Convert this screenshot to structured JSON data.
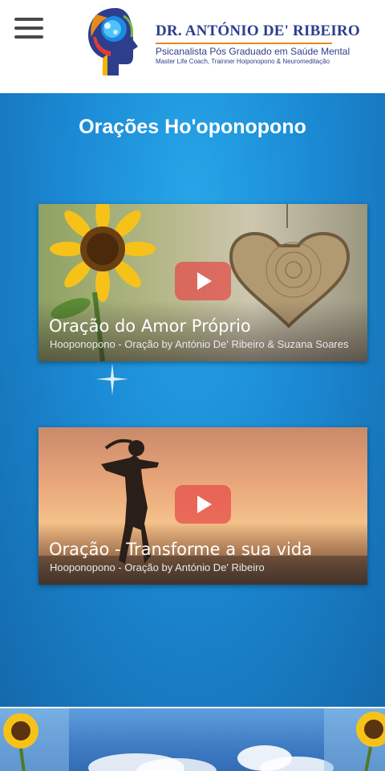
{
  "header": {
    "menu_label": "Menu",
    "brand_name": "DR. ANTÓNIO DE' RIBEIRO",
    "brand_subtitle": "Psicanalista Pós Graduado em Saúde Mental",
    "brand_tagline": "Master Life Coach, Trainner Hoiponopono & Neuromeditação"
  },
  "main": {
    "title": "Orações Ho'oponopono",
    "videos": [
      {
        "title": "Oração do Amor Próprio",
        "subtitle": "Hooponopono - Oração by António De' Ribeiro & Suzana Soares"
      },
      {
        "title": "Oração - Transforme a sua vida",
        "subtitle": "Hooponopono - Oração by António De' Ribeiro"
      }
    ]
  },
  "icons": [
    "menu-icon",
    "brain-head-logo-icon",
    "play-icon",
    "sparkle-icon"
  ],
  "colors": {
    "brand_blue": "#2c3e8c",
    "brand_orange": "#e58a1f",
    "background_blue": "#1b8ad4",
    "play_red": "#e64646"
  }
}
